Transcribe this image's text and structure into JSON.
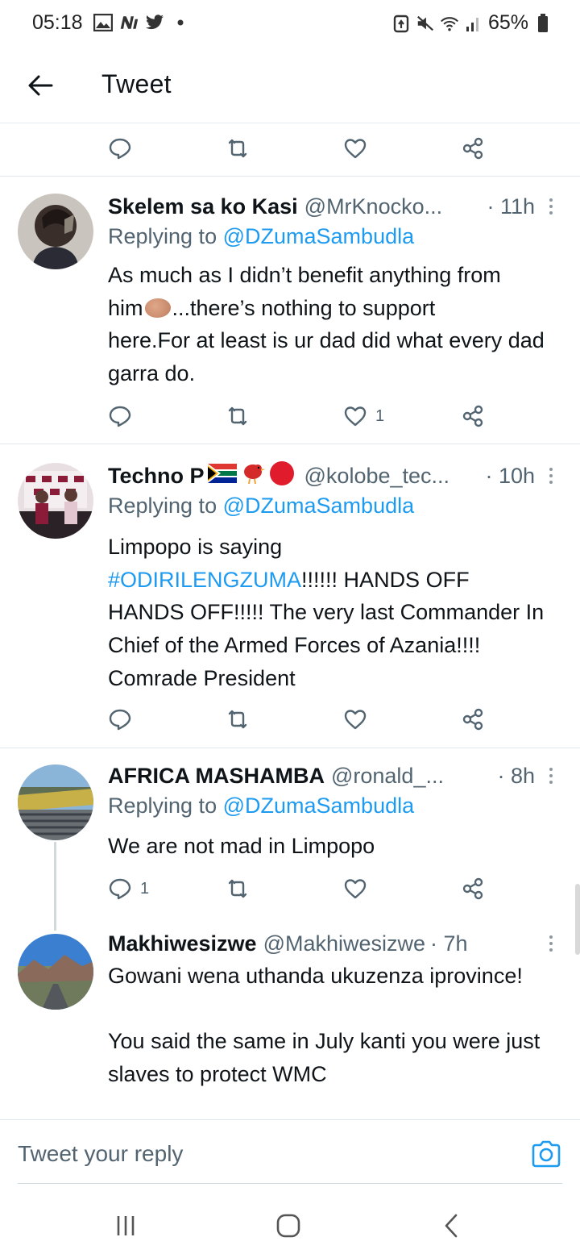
{
  "status_bar": {
    "time": "05:18",
    "battery": "65%",
    "left_icons": [
      "gallery-icon",
      "n-app-icon",
      "twitter-icon",
      "dot-icon"
    ],
    "right_icons": [
      "battery-saver-icon",
      "mute-icon",
      "wifi-icon",
      "signal-icon",
      "battery-icon"
    ]
  },
  "header": {
    "title": "Tweet"
  },
  "colors": {
    "accent": "#1d9bf0",
    "text": "#0f1419",
    "muted": "#536471",
    "divider": "#e1e8ed"
  },
  "tweets": [
    {
      "name": "Skelem sa ko Kasi",
      "handle": "@MrKnocko...",
      "time": "· 11h",
      "replying_prefix": "Replying to",
      "replying_to": "@DZumaSambudla",
      "body_line1_a": "As much as I didn’t benefit anything from",
      "body_line2_a": "him",
      "body_line2_b": "...there’s nothing to support",
      "body_rest": "here.For at least is ur dad did what every dad garra do.",
      "emoji": "potato-emoji",
      "likes": "1",
      "replies": "",
      "retweets": ""
    },
    {
      "name": "Techno P",
      "handle": "@kolobe_tec...",
      "time": "· 10h",
      "name_emojis": [
        "south-africa-flag-emoji",
        "red-bird-emoji",
        "red-circle-emoji"
      ],
      "replying_prefix": "Replying to",
      "replying_to": "@DZumaSambudla",
      "body_line1": "Limpopo is saying",
      "hashtag": "#ODIRILENGZUMA",
      "body_after_hashtag": "!!!!!! HANDS OFF",
      "body_rest": "HANDS OFF!!!!! The very last Commander In Chief of the Armed Forces of Azania!!!! Comrade President",
      "likes": "",
      "replies": "",
      "retweets": ""
    },
    {
      "name": "AFRICA MASHAMBA",
      "handle": "@ronald_...",
      "time": "· 8h",
      "replying_prefix": "Replying to",
      "replying_to": "@DZumaSambudla",
      "body": "We are not mad in Limpopo",
      "replies": "1",
      "likes": "",
      "retweets": ""
    },
    {
      "name": "Makhiwesizwe",
      "handle": "@Makhiwesizwe",
      "time": "· 7h",
      "body_p1": "Gowani wena uthanda ukuzenza iprovince!",
      "body_p2": "You said the same in July kanti you were just slaves to protect WMC"
    }
  ],
  "reply_bar": {
    "placeholder": "Tweet your reply"
  },
  "nav_bar": {
    "buttons": [
      "recent-apps-icon",
      "home-icon",
      "back-icon"
    ]
  }
}
